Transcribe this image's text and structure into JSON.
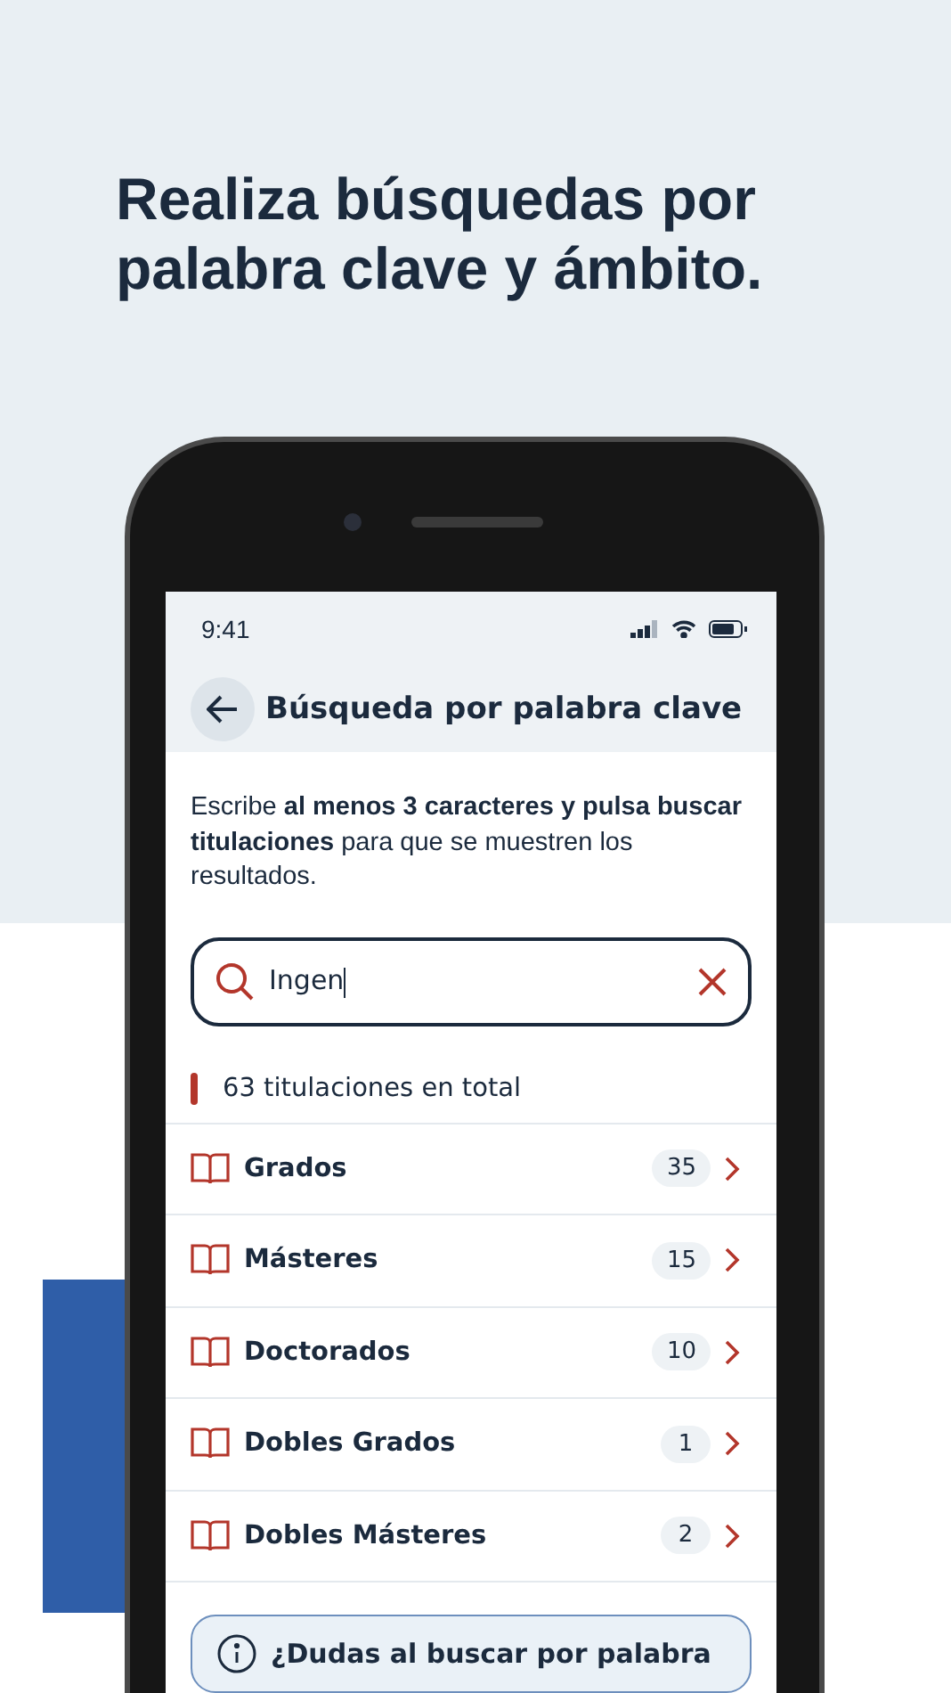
{
  "headline": "Realiza búsquedas por palabra clave y ámbito.",
  "status_bar": {
    "time": "9:41"
  },
  "header": {
    "title": "Búsqueda por palabra clave"
  },
  "instructions": "Escribe **al menos 3 caracteres y pulsa buscar titulaciones** para que se muestren los resultados.",
  "search": {
    "value": "Ingen"
  },
  "total": "63 titulaciones en total",
  "categories": [
    {
      "label": "Grados",
      "count": "35"
    },
    {
      "label": "Másteres",
      "count": "15"
    },
    {
      "label": "Doctorados",
      "count": "10"
    },
    {
      "label": "Dobles Grados",
      "count": "1"
    },
    {
      "label": "Dobles Másteres",
      "count": "2"
    }
  ],
  "info": {
    "text": "¿Dudas al buscar por palabra"
  }
}
